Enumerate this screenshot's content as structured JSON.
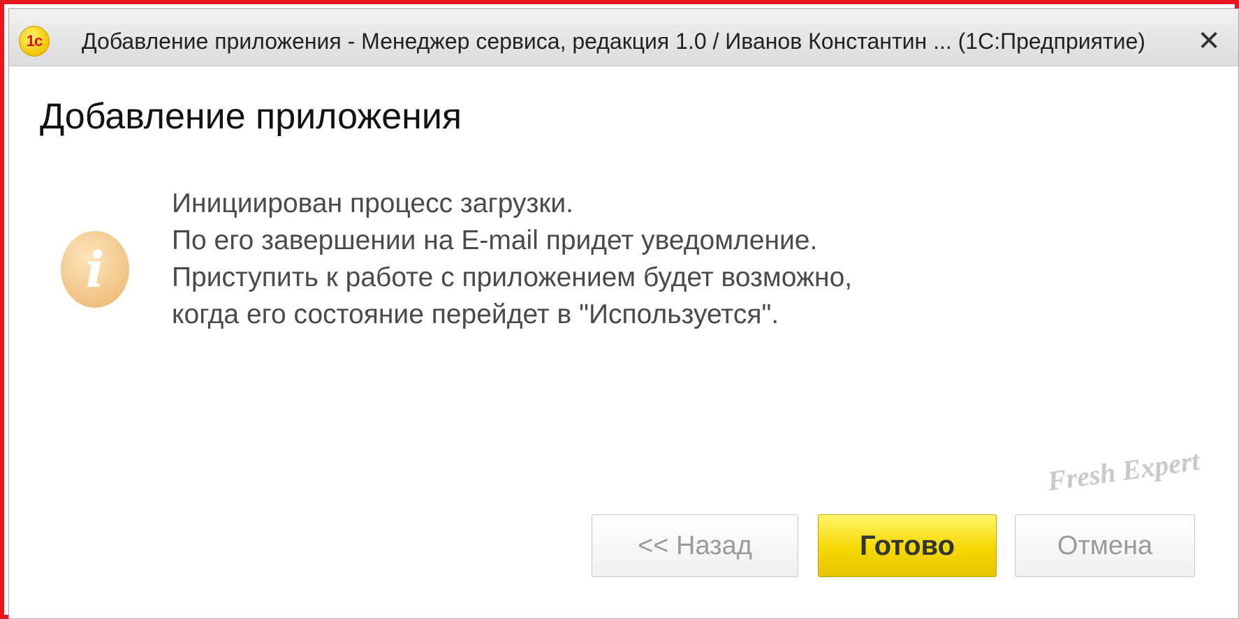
{
  "window": {
    "logo_text": "1с",
    "title": "Добавление приложения - Менеджер сервиса, редакция 1.0 / Иванов Константин ...   (1С:Предприятие)",
    "close_label": "✕"
  },
  "dialog": {
    "title": "Добавление приложения",
    "info_icon_glyph": "i",
    "message_lines": [
      "Инициирован процесс загрузки.",
      "По его завершении на E-mail придет уведомление.",
      "Приступить к работе с приложением будет возможно,",
      "когда его состояние перейдет в \"Используется\"."
    ]
  },
  "buttons": {
    "back_label": "<< Назад",
    "done_label": "Готово",
    "cancel_label": "Отмена"
  },
  "watermark": {
    "text": "Fresh Expert"
  },
  "colors": {
    "frame_border": "#e8171f",
    "done_button": "#f4d800",
    "info_icon": "#f2c78a"
  },
  "icons": {
    "app_logo": "1c-logo-icon",
    "close": "close-icon",
    "info": "info-icon"
  }
}
